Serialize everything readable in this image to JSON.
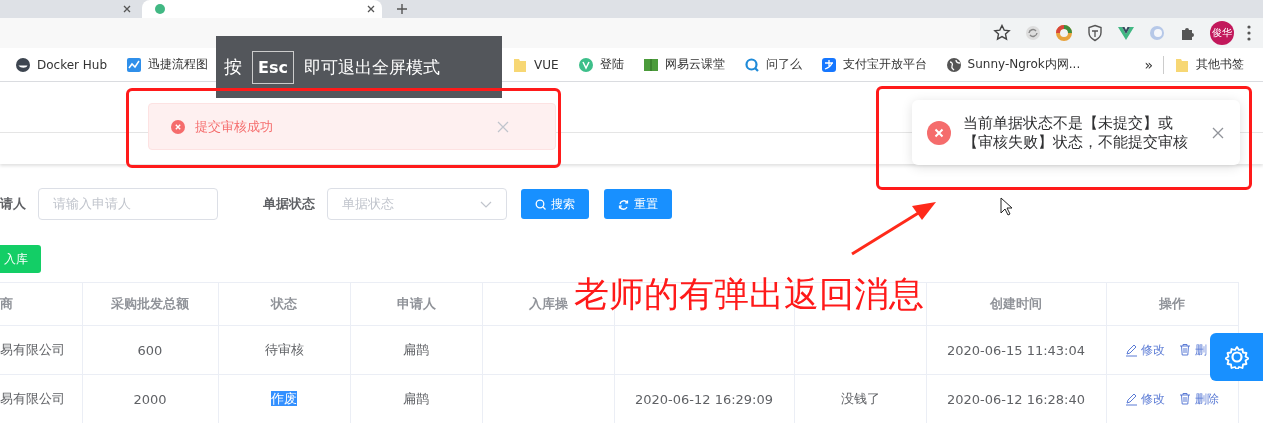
{
  "browser": {
    "tabs": [
      {
        "selected": false
      },
      {
        "selected": true
      }
    ],
    "profile": "俊华",
    "bookmarks": [
      {
        "label": "Docker Hub",
        "kind": "docker"
      },
      {
        "label": "迅捷流程图",
        "kind": "chart"
      },
      {
        "label": "VUE",
        "kind": "folder"
      },
      {
        "label": "登陆",
        "kind": "vue"
      },
      {
        "label": "网易云课堂",
        "kind": "book"
      },
      {
        "label": "问了么",
        "kind": "search"
      },
      {
        "label": "支付宝开放平台",
        "kind": "pay"
      },
      {
        "label": "Sunny-Ngrok内网...",
        "kind": "globe"
      }
    ],
    "bookmarks_overflow": "»",
    "other_bookmarks": "其他书签"
  },
  "fullscreen_notice": {
    "before": "按",
    "key": "Esc",
    "after": "即可退出全屏模式"
  },
  "message": {
    "text": "提交审核成功"
  },
  "notification": {
    "text": "当前单据状态不是【未提交】或【审核失败】状态，不能提交审核"
  },
  "search": {
    "fields": [
      {
        "label": "请人",
        "placeholder": "请输入申请人",
        "kind": "input"
      },
      {
        "label": "单据状态",
        "placeholder": "单据状态",
        "kind": "select"
      }
    ],
    "buttons": [
      {
        "label": "搜索",
        "kind": "search"
      },
      {
        "label": "重置",
        "kind": "reset"
      }
    ]
  },
  "add_button": "入库",
  "table": {
    "columns": [
      "商",
      "采购批发总额",
      "状态",
      "申请人",
      "入库操",
      null,
      null,
      "创建时间",
      "操作"
    ],
    "rows": [
      {
        "cells": [
          "易有限公司",
          "600",
          "待审核",
          "扁鹊",
          null,
          null,
          null,
          "2020-06-15 11:43:04"
        ],
        "actions": [
          {
            "label": "修改",
            "kind": "edit"
          },
          {
            "label": "删",
            "kind": "delete"
          }
        ]
      },
      {
        "cells": [
          "易有限公司",
          "2000",
          {
            "text": "作废",
            "highlighted": true
          },
          "扁鹊",
          null,
          "2020-06-12 16:29:09",
          "没钱了",
          "2020-06-12 16:28:40"
        ],
        "actions": [
          {
            "label": "修改",
            "kind": "edit"
          },
          {
            "label": "删除",
            "kind": "delete"
          }
        ]
      }
    ]
  },
  "annotation": {
    "text": "老师的有弹出返回消息"
  }
}
